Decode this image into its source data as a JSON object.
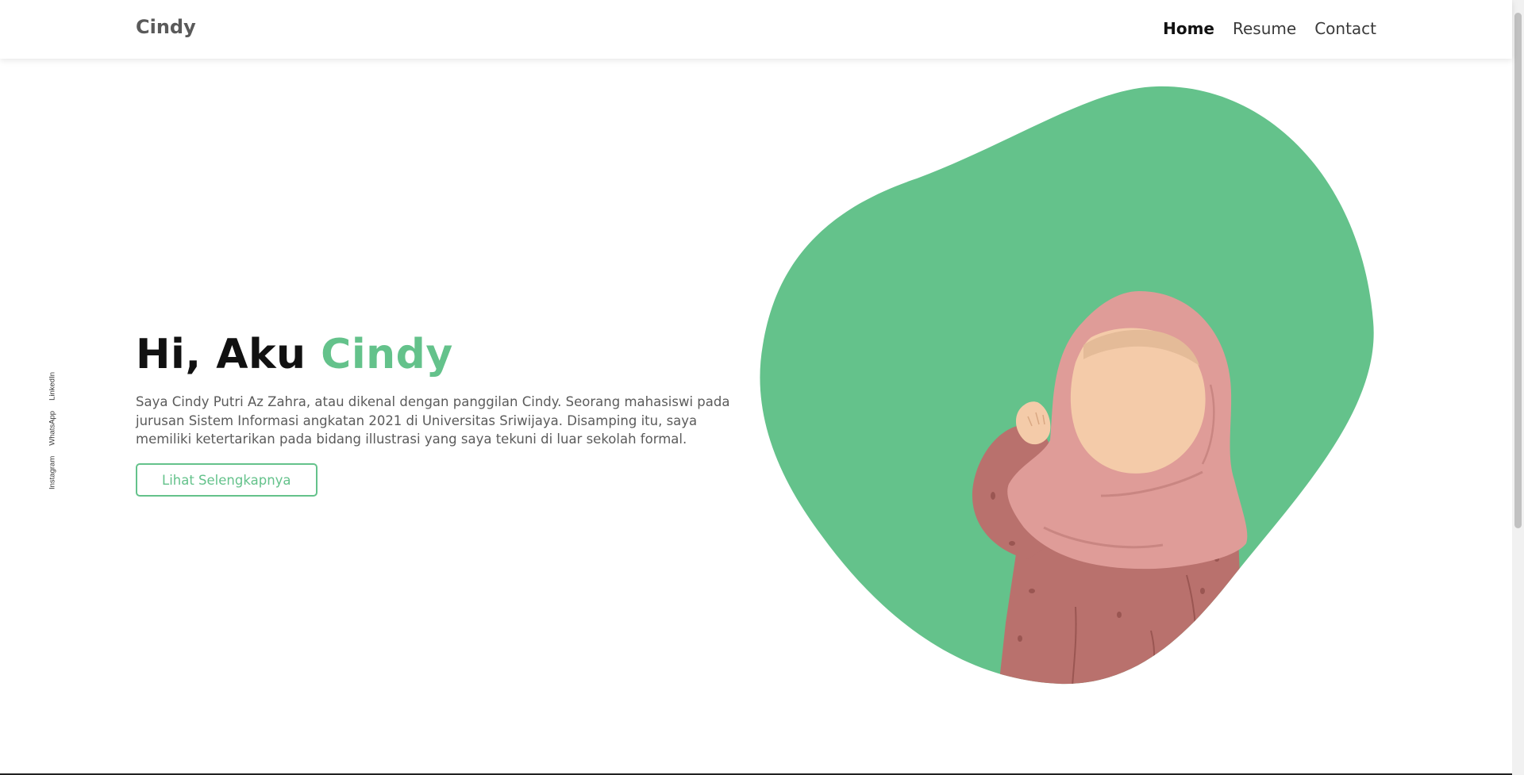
{
  "brand": "Cindy",
  "nav": [
    {
      "label": "Home",
      "active": true
    },
    {
      "label": "Resume",
      "active": false
    },
    {
      "label": "Contact",
      "active": false
    }
  ],
  "socials": [
    {
      "label": "Instagram"
    },
    {
      "label": "WhatsApp"
    },
    {
      "label": "LinkedIn"
    }
  ],
  "hero": {
    "greeting": "Hi, Aku",
    "name": "Cindy",
    "description": "Saya Cindy Putri Az Zahra, atau dikenal dengan panggilan Cindy. Seorang mahasiswi pada jurusan Sistem Informasi angkatan 2021 di Universitas Sriwijaya. Disamping itu, saya memiliki ketertarikan pada bidang illustrasi yang saya tekuni di luar sekolah formal.",
    "button": "Lihat Selengkapnya"
  },
  "colors": {
    "accent": "#64c28b",
    "hijab": "#df9c98",
    "skin": "#f4cba9",
    "dress": "#b9716d"
  },
  "illustration": {
    "icon": "girl-in-hijab-waving-illustration"
  }
}
